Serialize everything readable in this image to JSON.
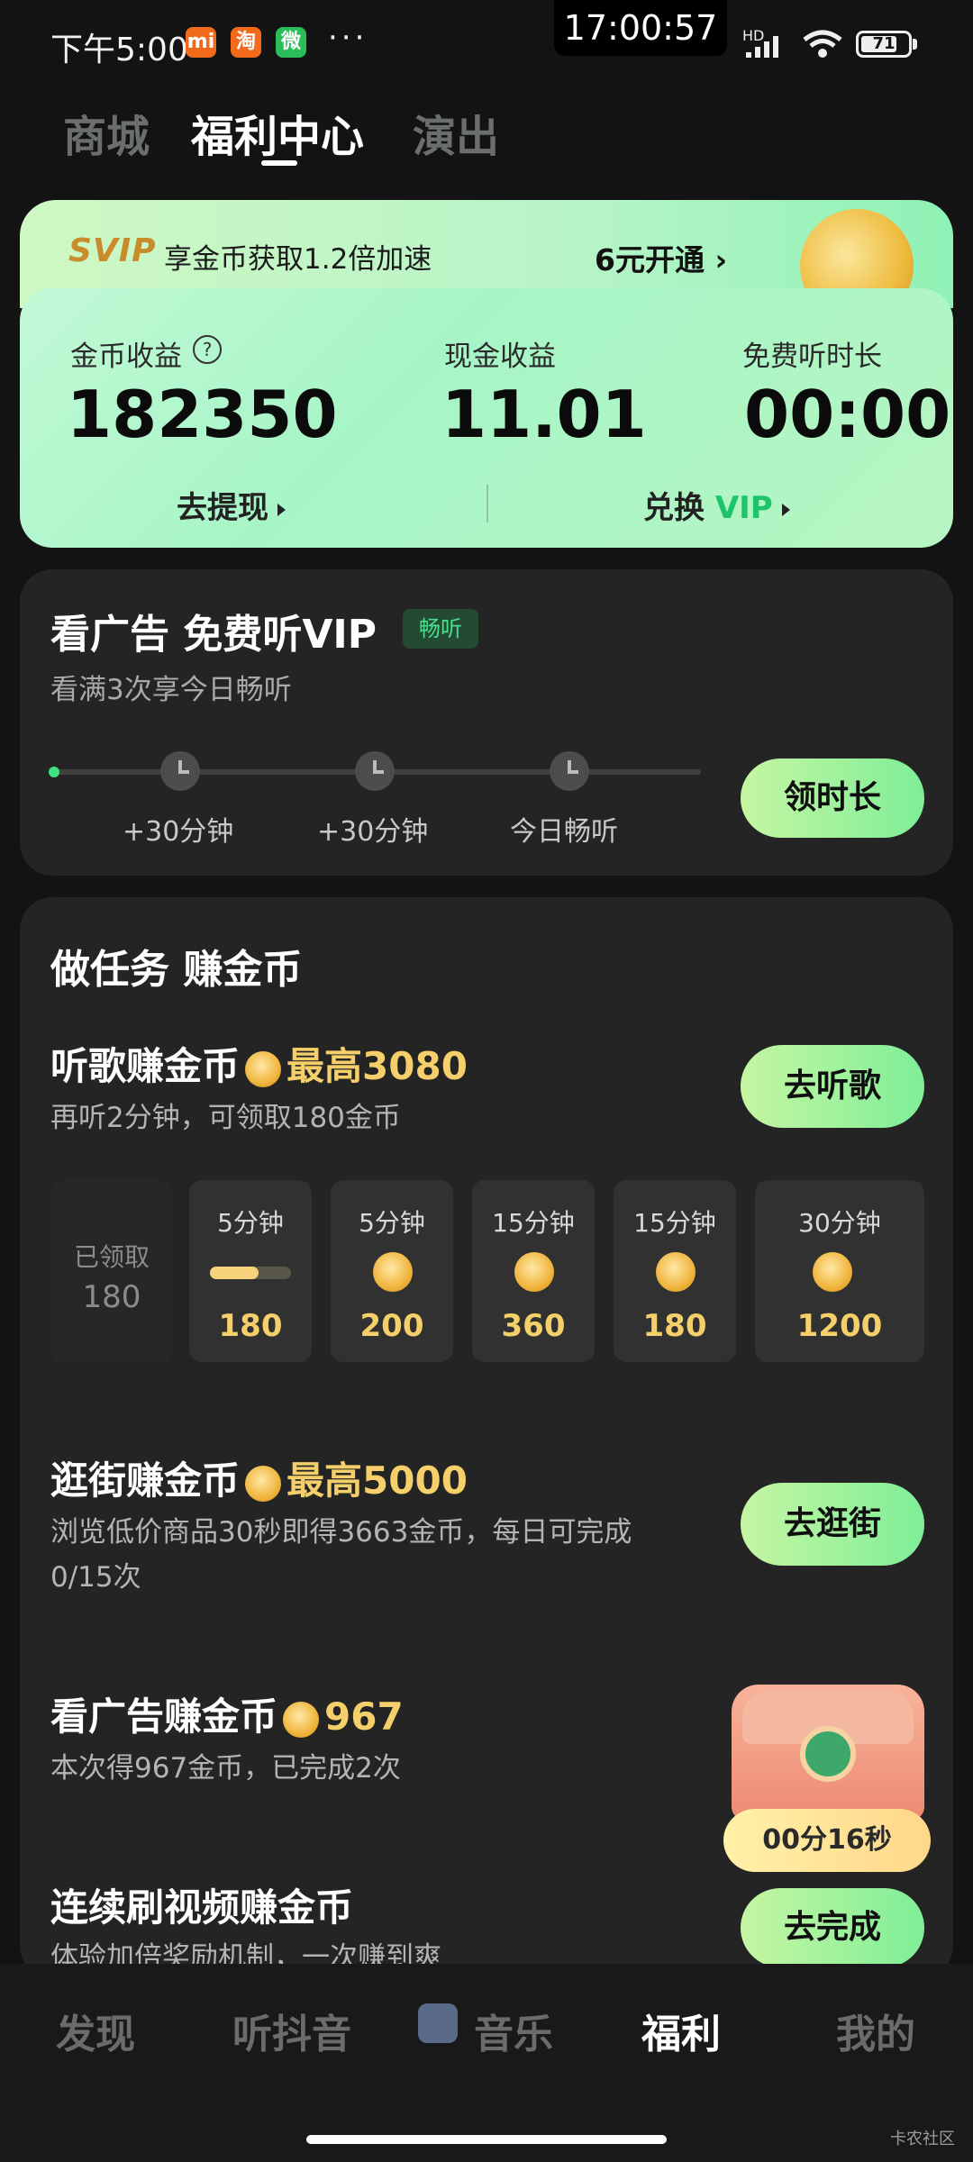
{
  "status_bar": {
    "time": "下午5:00",
    "apps": [
      "mi",
      "淘",
      "微"
    ],
    "more": "···",
    "clock": "17:00:57",
    "hd": "HD",
    "battery": "71"
  },
  "top_tabs": [
    "商城",
    "福利中心",
    "演出"
  ],
  "vip_card": {
    "svip_label": "SVIP",
    "svip_text": "享金币获取1.2倍加速",
    "open_label": "6元开通",
    "stats": [
      {
        "label": "金币收益",
        "value": "182350"
      },
      {
        "label": "现金收益",
        "value": "11.01"
      },
      {
        "label": "免费听时长",
        "value": "00:00"
      }
    ],
    "withdraw": "去提现",
    "exchange": "兑换",
    "exchange_vip": "VIP"
  },
  "ad_panel": {
    "title": "看广告 免费听VIP",
    "badge": "畅听",
    "subtitle": "看满3次享今日畅听",
    "ticks": [
      "+30分钟",
      "+30分钟",
      "今日畅听"
    ],
    "button": "领时长"
  },
  "tasks": {
    "title": "做任务 赚金币",
    "music": {
      "title": "听歌赚金币",
      "max_label": "最高",
      "max_value": "3080",
      "subtitle": "再听2分钟，可领取180金币",
      "button": "去听歌",
      "tiles": [
        {
          "label": "已领取",
          "value": "180"
        },
        {
          "label": "5分钟",
          "value": "180",
          "progress": 0.6
        },
        {
          "label": "5分钟",
          "value": "200"
        },
        {
          "label": "15分钟",
          "value": "360"
        },
        {
          "label": "15分钟",
          "value": "180"
        },
        {
          "label": "30分钟",
          "value": "1200"
        }
      ]
    },
    "shop": {
      "title": "逛街赚金币",
      "max_label": "最高",
      "max_value": "5000",
      "subtitle_1": "浏览低价商品30秒即得3663金币，每日可完成",
      "subtitle_2": "0/15次",
      "button": "去逛街"
    },
    "ad": {
      "title": "看广告赚金币",
      "value": "967",
      "subtitle": "本次得967金币，已完成2次",
      "timer": "00分16秒"
    },
    "video": {
      "title": "连续刷视频赚金币",
      "subtitle": "体验加倍奖励机制，一次赚到爽",
      "button": "去完成"
    }
  },
  "bottom_nav": [
    "发现",
    "听抖音",
    "音乐",
    "福利",
    "我的"
  ],
  "watermark": "卡农社区"
}
